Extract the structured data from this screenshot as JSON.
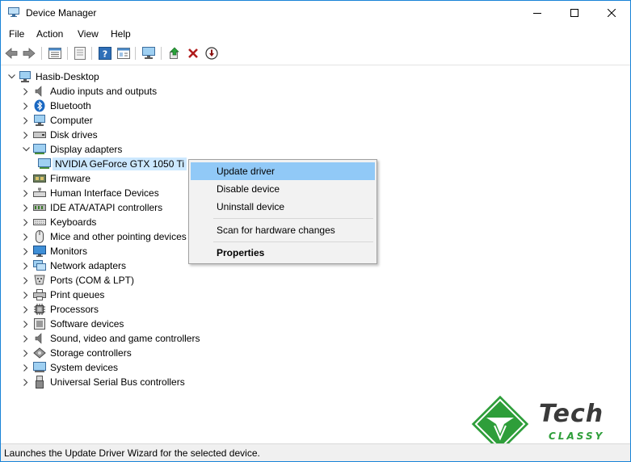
{
  "window": {
    "title": "Device Manager",
    "controls": [
      "minimize",
      "maximize",
      "close"
    ]
  },
  "menubar": {
    "items": [
      "File",
      "Action",
      "View",
      "Help"
    ]
  },
  "toolbar": {
    "icons": [
      "back-icon",
      "forward-icon",
      "view-tree-icon",
      "properties-sheet-icon",
      "help-icon",
      "resources-view-icon",
      "display-computer-icon",
      "update-driver-icon",
      "uninstall-x-icon",
      "disable-device-icon"
    ]
  },
  "tree": {
    "root": "Hasib-Desktop",
    "categories": [
      {
        "label": "Audio inputs and outputs",
        "icon": "speaker-icon",
        "expanded": false
      },
      {
        "label": "Bluetooth",
        "icon": "bluetooth-icon",
        "expanded": false
      },
      {
        "label": "Computer",
        "icon": "computer-icon",
        "expanded": false
      },
      {
        "label": "Disk drives",
        "icon": "disk-drive-icon",
        "expanded": false
      },
      {
        "label": "Display adapters",
        "icon": "display-adapter-icon",
        "expanded": true,
        "children": [
          {
            "label": "NVIDIA GeForce GTX 1050 Ti",
            "icon": "gpu-icon",
            "selected": true
          }
        ]
      },
      {
        "label": "Firmware",
        "icon": "firmware-icon",
        "expanded": false
      },
      {
        "label": "Human Interface Devices",
        "icon": "hid-icon",
        "expanded": false
      },
      {
        "label": "IDE ATA/ATAPI controllers",
        "icon": "ide-controller-icon",
        "expanded": false
      },
      {
        "label": "Keyboards",
        "icon": "keyboard-icon",
        "expanded": false
      },
      {
        "label": "Mice and other pointing devices",
        "icon": "mouse-icon",
        "expanded": false
      },
      {
        "label": "Monitors",
        "icon": "monitor-icon",
        "expanded": false
      },
      {
        "label": "Network adapters",
        "icon": "network-icon",
        "expanded": false
      },
      {
        "label": "Ports (COM & LPT)",
        "icon": "port-icon",
        "expanded": false
      },
      {
        "label": "Print queues",
        "icon": "printer-icon",
        "expanded": false
      },
      {
        "label": "Processors",
        "icon": "processor-icon",
        "expanded": false
      },
      {
        "label": "Software devices",
        "icon": "software-device-icon",
        "expanded": false
      },
      {
        "label": "Sound, video and game controllers",
        "icon": "sound-icon",
        "expanded": false
      },
      {
        "label": "Storage controllers",
        "icon": "storage-controller-icon",
        "expanded": false
      },
      {
        "label": "System devices",
        "icon": "system-device-icon",
        "expanded": false
      },
      {
        "label": "Universal Serial Bus controllers",
        "icon": "usb-icon",
        "expanded": false
      }
    ]
  },
  "context_menu": {
    "items": [
      {
        "label": "Update driver",
        "highlighted": true
      },
      {
        "label": "Disable device"
      },
      {
        "label": "Uninstall device"
      },
      {
        "label": "Scan for hardware changes"
      },
      {
        "label": "Properties",
        "bold": true
      }
    ]
  },
  "statusbar": {
    "text": "Launches the Update Driver Wizard for the selected device."
  },
  "watermark": {
    "line1": "Tech",
    "line2": "CLASSY"
  },
  "colors": {
    "accent": "#1883d7",
    "selection": "#cce8ff",
    "menu_highlight": "#91c9f7",
    "logo_green": "#2e9e3a"
  }
}
